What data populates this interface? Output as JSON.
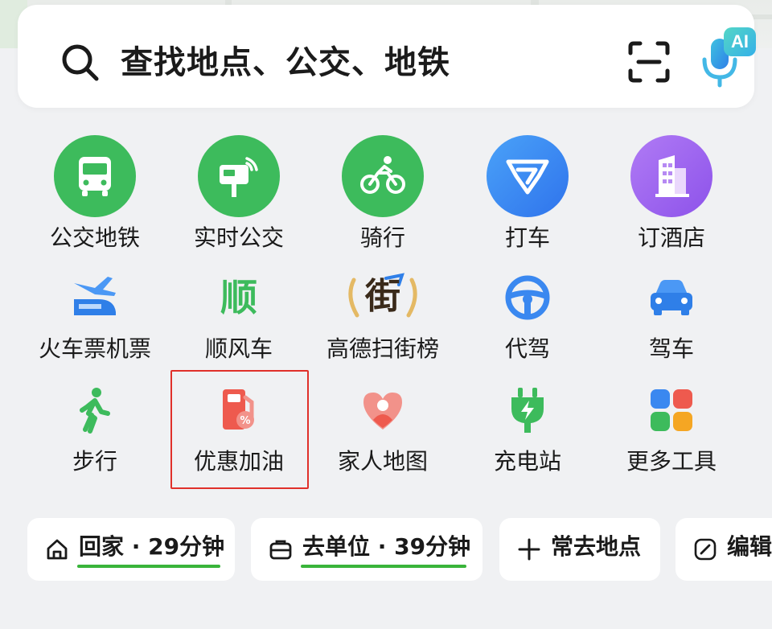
{
  "search": {
    "placeholder": "查找地点、公交、地铁",
    "ai_badge": "AI"
  },
  "tools": [
    {
      "label": "公交地铁",
      "icon": "bus-icon",
      "color": "#3dbb5c"
    },
    {
      "label": "实时公交",
      "icon": "realtime-bus-icon",
      "color": "#3dbb5c"
    },
    {
      "label": "骑行",
      "icon": "bicycle-icon",
      "color": "#3dbb5c"
    },
    {
      "label": "打车",
      "icon": "taxi-logo-icon",
      "color": "#3b8cf5"
    },
    {
      "label": "订酒店",
      "icon": "hotel-icon",
      "color": "#9a62f0"
    },
    {
      "label": "火车票机票",
      "icon": "train-plane-icon",
      "color": "#3a88f0"
    },
    {
      "label": "顺风车",
      "icon": "shunfeng-icon",
      "glyph": "顺",
      "color": "#3dbb5c"
    },
    {
      "label": "高德扫街榜",
      "icon": "street-ranking-icon",
      "glyph": "街",
      "color": "#3a2a1a"
    },
    {
      "label": "代驾",
      "icon": "steering-wheel-icon",
      "color": "#3a88f0"
    },
    {
      "label": "驾车",
      "icon": "car-icon",
      "color": "#3a88f0"
    },
    {
      "label": "步行",
      "icon": "walking-icon",
      "color": "#3dbb5c"
    },
    {
      "label": "优惠加油",
      "icon": "fuel-discount-icon",
      "color": "#ee5a4e"
    },
    {
      "label": "家人地图",
      "icon": "family-map-icon",
      "color": "#ee5a4e"
    },
    {
      "label": "充电站",
      "icon": "charging-icon",
      "color": "#3dbb5c"
    },
    {
      "label": "更多工具",
      "icon": "more-tools-icon",
      "color": "#3a88f0"
    }
  ],
  "shortcuts": {
    "home": {
      "label": "回家",
      "eta": " · 29分钟"
    },
    "work": {
      "label": "去单位",
      "eta": " · 39分钟"
    },
    "frequent": {
      "label": "常去地点"
    },
    "edit": {
      "label": "编辑"
    }
  }
}
